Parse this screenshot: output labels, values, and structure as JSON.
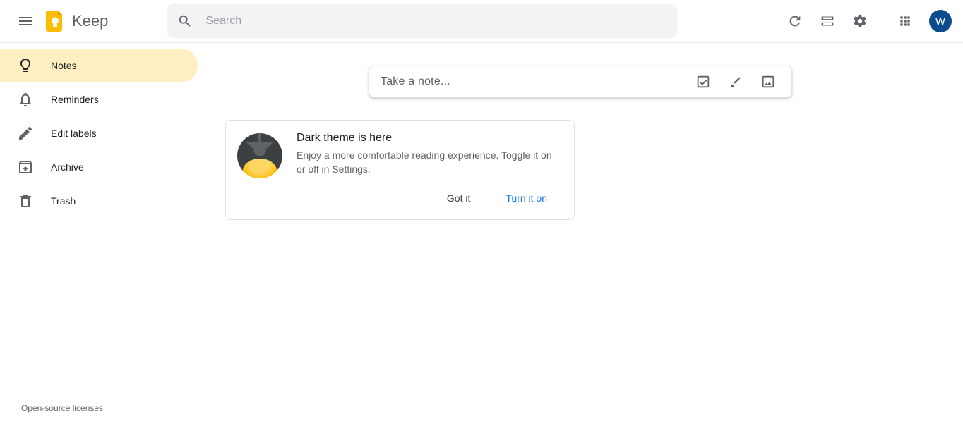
{
  "header": {
    "product_name": "Keep",
    "search_placeholder": "Search",
    "avatar_initial": "W"
  },
  "sidebar": {
    "items": [
      {
        "label": "Notes",
        "active": true,
        "icon": "bulb"
      },
      {
        "label": "Reminders",
        "active": false,
        "icon": "bell"
      },
      {
        "label": "Edit labels",
        "active": false,
        "icon": "pencil"
      },
      {
        "label": "Archive",
        "active": false,
        "icon": "archive"
      },
      {
        "label": "Trash",
        "active": false,
        "icon": "trash"
      }
    ]
  },
  "note_input": {
    "placeholder": "Take a note..."
  },
  "promo": {
    "title": "Dark theme is here",
    "body": "Enjoy a more comfortable reading experience. Toggle it on or off in Settings.",
    "dismiss_label": "Got it",
    "action_label": "Turn it on"
  },
  "footer": {
    "licenses": "Open-source licenses"
  }
}
